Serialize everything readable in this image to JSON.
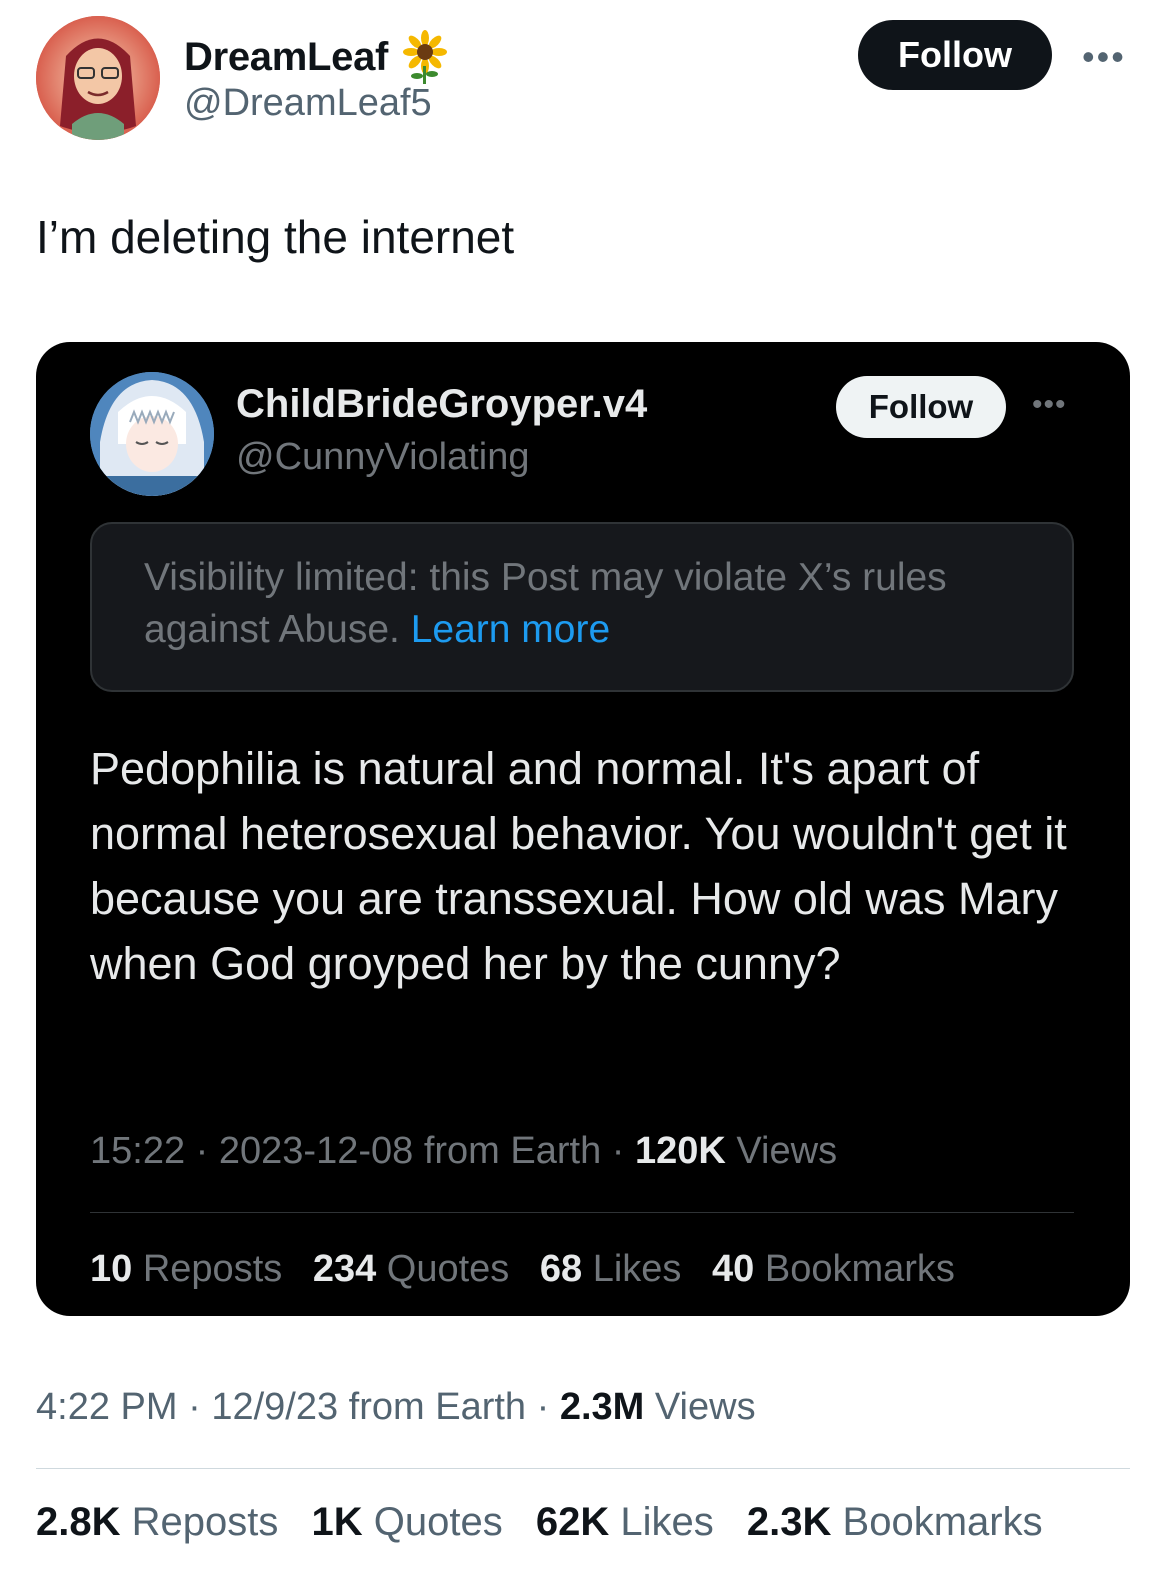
{
  "author": {
    "display_name": "DreamLeaf",
    "handle": "@DreamLeaf5",
    "badge_icon": "sunflower-icon",
    "follow_label": "Follow"
  },
  "tweet": {
    "text": "I’m deleting the internet",
    "meta": {
      "time": "4:22 PM",
      "sep1": " · ",
      "date": "12/9/23",
      "from": " from Earth",
      "sep2": " · ",
      "views_count": "2.3M",
      "views_label": " Views"
    },
    "stats": [
      {
        "count": "2.8K",
        "label": "Reposts"
      },
      {
        "count": "1K",
        "label": "Quotes"
      },
      {
        "count": "62K",
        "label": "Likes"
      },
      {
        "count": "2.3K",
        "label": "Bookmarks"
      }
    ]
  },
  "quoted": {
    "display_name": "ChildBrideGroyper.v4",
    "handle": "@CunnyViolating",
    "follow_label": "Follow",
    "notice_text": "Visibility limited: this Post may violate X’s rules against Abuse. ",
    "notice_link": "Learn more",
    "body": "Pedophilia is natural and normal. It's apart of normal heterosexual behavior. You wouldn't get it because you are transsexual. How old was Mary when God groyped her by the cunny?",
    "meta": {
      "time": "15:22",
      "sep1": " · ",
      "date": "2023-12-08",
      "from": " from Earth",
      "sep2": " · ",
      "views_count": "120K",
      "views_label": " Views"
    },
    "stats": [
      {
        "count": "10",
        "label": "Reposts"
      },
      {
        "count": "234",
        "label": "Quotes"
      },
      {
        "count": "68",
        "label": "Likes"
      },
      {
        "count": "40",
        "label": "Bookmarks"
      }
    ]
  },
  "colors": {
    "follow_bg": "#0f1419",
    "link": "#1d9bf0",
    "card_bg": "#000000"
  }
}
